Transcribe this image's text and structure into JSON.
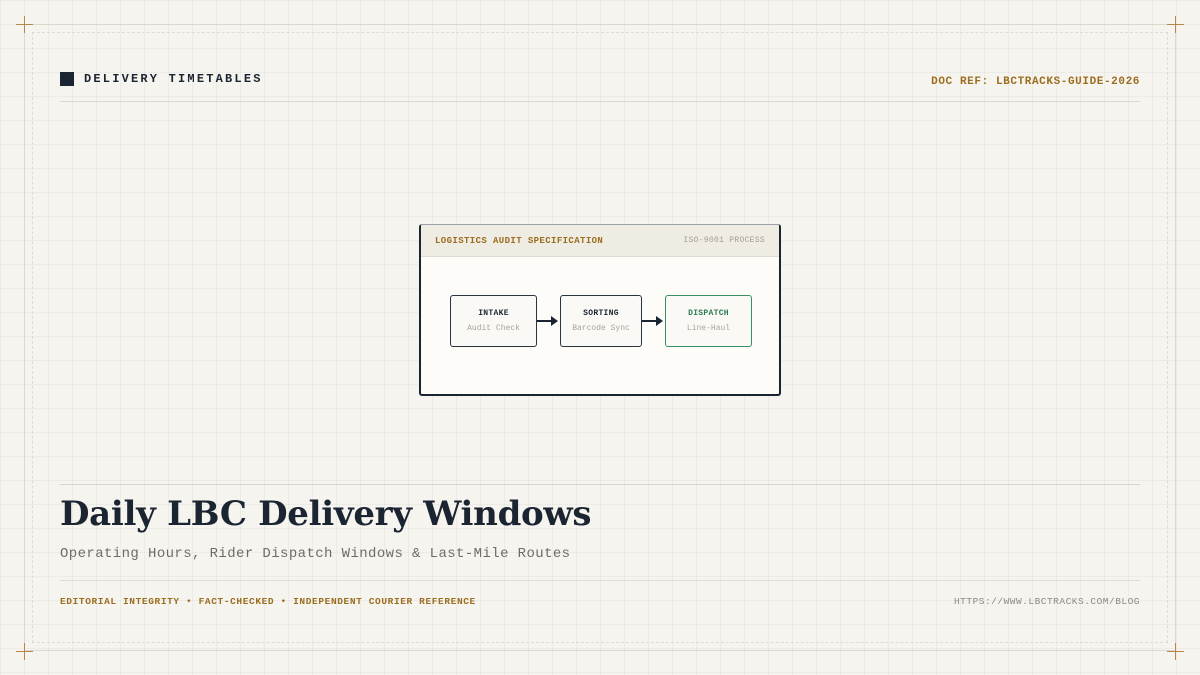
{
  "header": {
    "title": "DELIVERY TIMETABLES",
    "doc_ref": "DOC REF: LBCTRACKS-GUIDE-2026"
  },
  "diagram": {
    "title": "LOGISTICS AUDIT SPECIFICATION",
    "tag": "ISO-9001 PROCESS",
    "steps": [
      {
        "label": "INTAKE",
        "sub": "Audit Check"
      },
      {
        "label": "SORTING",
        "sub": "Barcode Sync"
      },
      {
        "label": "DISPATCH",
        "sub": "Line-Haul"
      }
    ]
  },
  "main": {
    "title": "Daily LBC Delivery Windows",
    "subtitle": "Operating Hours, Rider Dispatch Windows & Last-Mile Routes"
  },
  "footer": {
    "left": "EDITORIAL INTEGRITY • FACT-CHECKED • INDEPENDENT COURIER REFERENCE",
    "right": "HTTPS://WWW.LBCTRACKS.COM/BLOG"
  },
  "colors": {
    "accent": "#9b6d1f",
    "ink": "#1b2431",
    "success": "#2c7a52"
  }
}
